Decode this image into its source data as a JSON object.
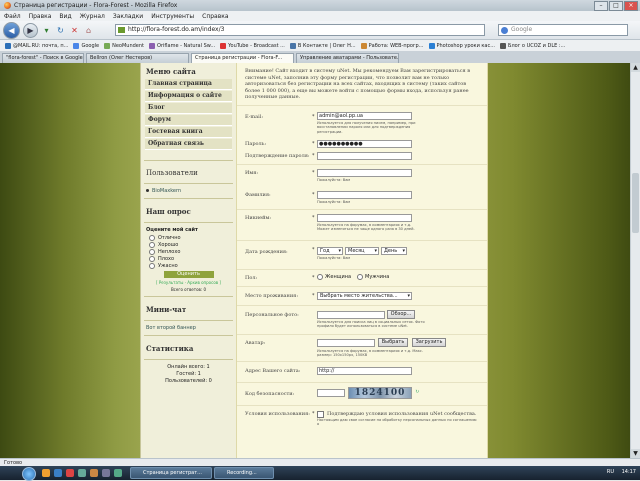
{
  "window": {
    "title": "Страница регистрации - Flora-Forest - Mozilla Firefox",
    "buttons": {
      "minimize": "–",
      "maximize": "□",
      "close": "×"
    }
  },
  "menu": [
    "Файл",
    "Правка",
    "Вид",
    "Журнал",
    "Закладки",
    "Инструменты",
    "Справка"
  ],
  "nav": {
    "url": "http://flora-forest.do.am/index/3",
    "search_placeholder": "Google"
  },
  "bookmarks": [
    {
      "label": "@MAIL.RU: почта, п...",
      "color": "#2c6fb7"
    },
    {
      "label": "Google",
      "color": "#4a86e8"
    },
    {
      "label": "NeoMundent",
      "color": "#7a5"
    },
    {
      "label": "Oriflame - Natural Sw...",
      "color": "#8b5fb0"
    },
    {
      "label": "YouTube - Broadcast ...",
      "color": "#d33"
    },
    {
      "label": "В Контакте | Олег Н...",
      "color": "#4a76a8"
    },
    {
      "label": "Работа: WEB-прогр...",
      "color": "#c83"
    },
    {
      "label": "Photoshop уроки кас...",
      "color": "#2a7fd4"
    },
    {
      "label": "Блог о UCOZ и DLE :...",
      "color": "#555"
    }
  ],
  "tabs": [
    {
      "label": "\"flora-forest\" - Поиск в Google",
      "active": false
    },
    {
      "label": "Bellron (Олег Нестеров)",
      "active": false
    },
    {
      "label": "Страница регистрации - Flora-F...",
      "active": true
    },
    {
      "label": "Управление аватарами - Пользовате...",
      "active": false
    }
  ],
  "sidebar": {
    "menu_title": "Меню сайта",
    "menu_items": [
      "Главная страница",
      "Информация о сайте",
      "Блог",
      "Форум",
      "Гостевая книга",
      "Обратная связь"
    ],
    "users_title": "Пользователи",
    "users": [
      "BioMaxkern"
    ],
    "poll_title": "Наш опрос",
    "poll_question": "Оцените мой сайт",
    "poll_options": [
      "Отлично",
      "Хорошо",
      "Неплохо",
      "Плохо",
      "Ужасно"
    ],
    "vote_button": "Оценить",
    "poll_results": "[ Результаты · Архив опросов ]",
    "poll_total": "Всего ответов: 0",
    "minichat_title": "Мини-чат",
    "minichat_link": "Вот второй баннер",
    "stats_title": "Статистика",
    "stats": [
      "Онлайн всего: 1",
      "Гостей: 1",
      "Пользователей: 0"
    ]
  },
  "form": {
    "intro": "Внимание! Сайт входит в систему uNet. Мы рекомендуем Вам зарегистрироваться в системе uNet, заполнив эту форму регистрации, что позволит вам не только авторизоваться без регистрации на всех сайтах, входящих в систему (таких сайтов более 1 000 000), а еще вы можете войти с помощью формы входа, используя ранее полученные данные.",
    "email": {
      "label": "E-mail:",
      "value": "admin@aol.pp.ua",
      "hint": "Используется для получения писем, например, при восстановлении пароля или для подтверждения регистрации."
    },
    "password": {
      "label": "Пароль:",
      "value": "●●●●●●●●●●"
    },
    "password_confirm": {
      "label": "Подтверждение пароля:",
      "value": ""
    },
    "name": {
      "label": "Имя:",
      "value": "",
      "hint": "Пожалуйста: Вам"
    },
    "surname": {
      "label": "Фамилия:",
      "value": "",
      "hint": "Пожалуйста: Вам"
    },
    "nickname": {
      "label": "Никнейм:",
      "value": "",
      "hint": "Используется на форумах, в комментариях и т.д. Может изменяться не чаще одного раза в 30 дней."
    },
    "birthday": {
      "label": "Дата рождения:",
      "day": "Год",
      "month": "Месяц",
      "year": "День",
      "hint": "Пожалуйста: Вам"
    },
    "gender": {
      "label": "Пол:",
      "male": "Женщина",
      "female": "Мужчина"
    },
    "residence": {
      "label": "Место проживания:",
      "value": "Выбрать место жительства..."
    },
    "photo": {
      "label": "Персональное фото:",
      "button": "Обзор...",
      "hint": "Используется для поиска лиц в социальных сетях. Фото профиля будет использоваться в системе uNet."
    },
    "avatar": {
      "label": "Аватар:",
      "select_button": "Выбрать",
      "upload_button": "Загрузить",
      "hint": "Используется на форумах, в комментариях и т.д. Макс. размер: 150x150px, 150KB"
    },
    "website": {
      "label": "Адрес Вашего сайта:",
      "value": "http://"
    },
    "captcha": {
      "label": "Код безопасности:",
      "code": "1824100",
      "refresh": "↻"
    },
    "terms": {
      "label": "Условия использования:",
      "text": "Подтверждаю условия использования uNet сообщества.",
      "subtext": "Настоящим даю свое согласие на обработку персональных данных по соглашению о"
    }
  },
  "statusbar": "Готово",
  "taskbar": {
    "tasks": [
      "Страница регистрат...",
      "Recording..."
    ],
    "clock": "14:17",
    "lang": "RU"
  }
}
